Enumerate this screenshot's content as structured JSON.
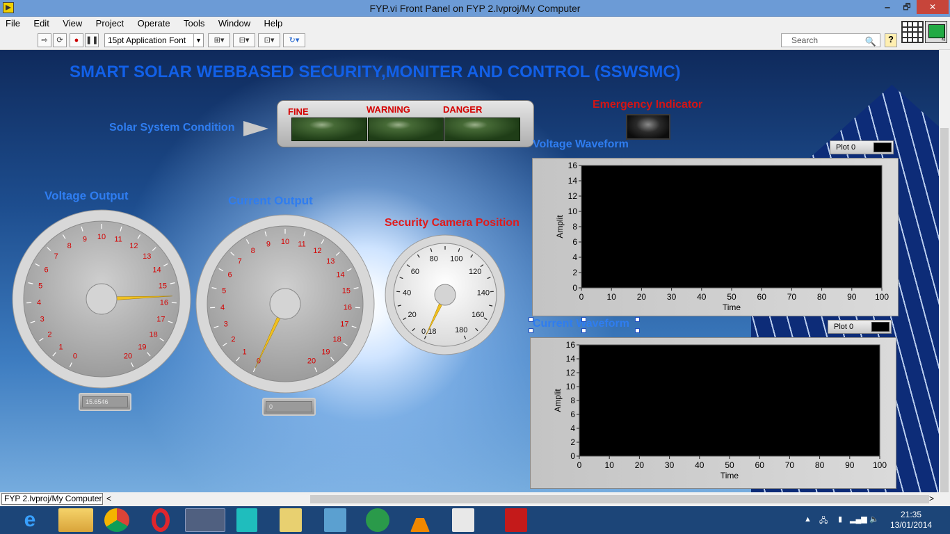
{
  "window": {
    "title": "FYP.vi Front Panel on FYP 2.lvproj/My Computer",
    "min": "🗕",
    "max": "🗗",
    "close": "✕"
  },
  "menu": [
    "File",
    "Edit",
    "View",
    "Project",
    "Operate",
    "Tools",
    "Window",
    "Help"
  ],
  "toolbar": {
    "font": "15pt Application Font",
    "search_placeholder": "Search",
    "help": "?",
    "vi_icon_number": "4"
  },
  "panel": {
    "title": "SMART SOLAR WEBBASED SECURITY,MONITER AND CONTROL (SSWSMC)",
    "solar_condition_label": "Solar System Condition",
    "condition_leds": [
      "FINE",
      "WARNING",
      "DANGER"
    ],
    "emergency_label": "Emergency Indicator",
    "voltage_output_label": "Voltage Output",
    "current_output_label": "Current Output",
    "camera_label": "Security Camera Position",
    "voltage_waveform_label": "Voltage Waveform",
    "current_waveform_label": "Current Waveform",
    "voltage_value": "15.6546",
    "current_value": "0"
  },
  "gauges": {
    "voltage": {
      "min": 0,
      "max": 20,
      "ticks": [
        0,
        1,
        2,
        3,
        4,
        5,
        6,
        7,
        8,
        9,
        10,
        11,
        12,
        13,
        14,
        15,
        16,
        17,
        18,
        19,
        20
      ],
      "value": 15.6546
    },
    "current": {
      "min": 0,
      "max": 20,
      "ticks": [
        0,
        1,
        2,
        3,
        4,
        5,
        6,
        7,
        8,
        9,
        10,
        11,
        12,
        13,
        14,
        15,
        16,
        17,
        18,
        19,
        20
      ],
      "value": 0
    },
    "camera": {
      "min": 0,
      "max": 180,
      "ticks": [
        20,
        40,
        60,
        80,
        100,
        120,
        140,
        160,
        180
      ],
      "min_label": "0.18",
      "value": 0.18
    }
  },
  "charts": {
    "voltage": {
      "legend": "Plot 0",
      "ylabel": "Amplit",
      "xlabel": "Time",
      "x_ticks": [
        "0",
        "10",
        "20",
        "30",
        "40",
        "50",
        "60",
        "70",
        "80",
        "90",
        "100"
      ],
      "y_ticks": [
        "0",
        "2",
        "4",
        "6",
        "8",
        "10",
        "12",
        "14",
        "16"
      ]
    },
    "current": {
      "legend": "Plot 0",
      "ylabel": "Amplit",
      "xlabel": "Time",
      "x_ticks": [
        "0",
        "10",
        "20",
        "30",
        "40",
        "50",
        "60",
        "70",
        "80",
        "90",
        "100"
      ],
      "y_ticks": [
        "0",
        "2",
        "4",
        "6",
        "8",
        "10",
        "12",
        "14",
        "16"
      ]
    }
  },
  "status": {
    "path": "FYP 2.lvproj/My Computer",
    "arrow_left": "<",
    "arrow_right": ">"
  },
  "taskbar": {
    "time": "21:35",
    "date": "13/01/2014"
  },
  "colors": {
    "gauge_label_red": "#d40000",
    "needle": "#f0c020",
    "title_blue": "#1260e8"
  }
}
